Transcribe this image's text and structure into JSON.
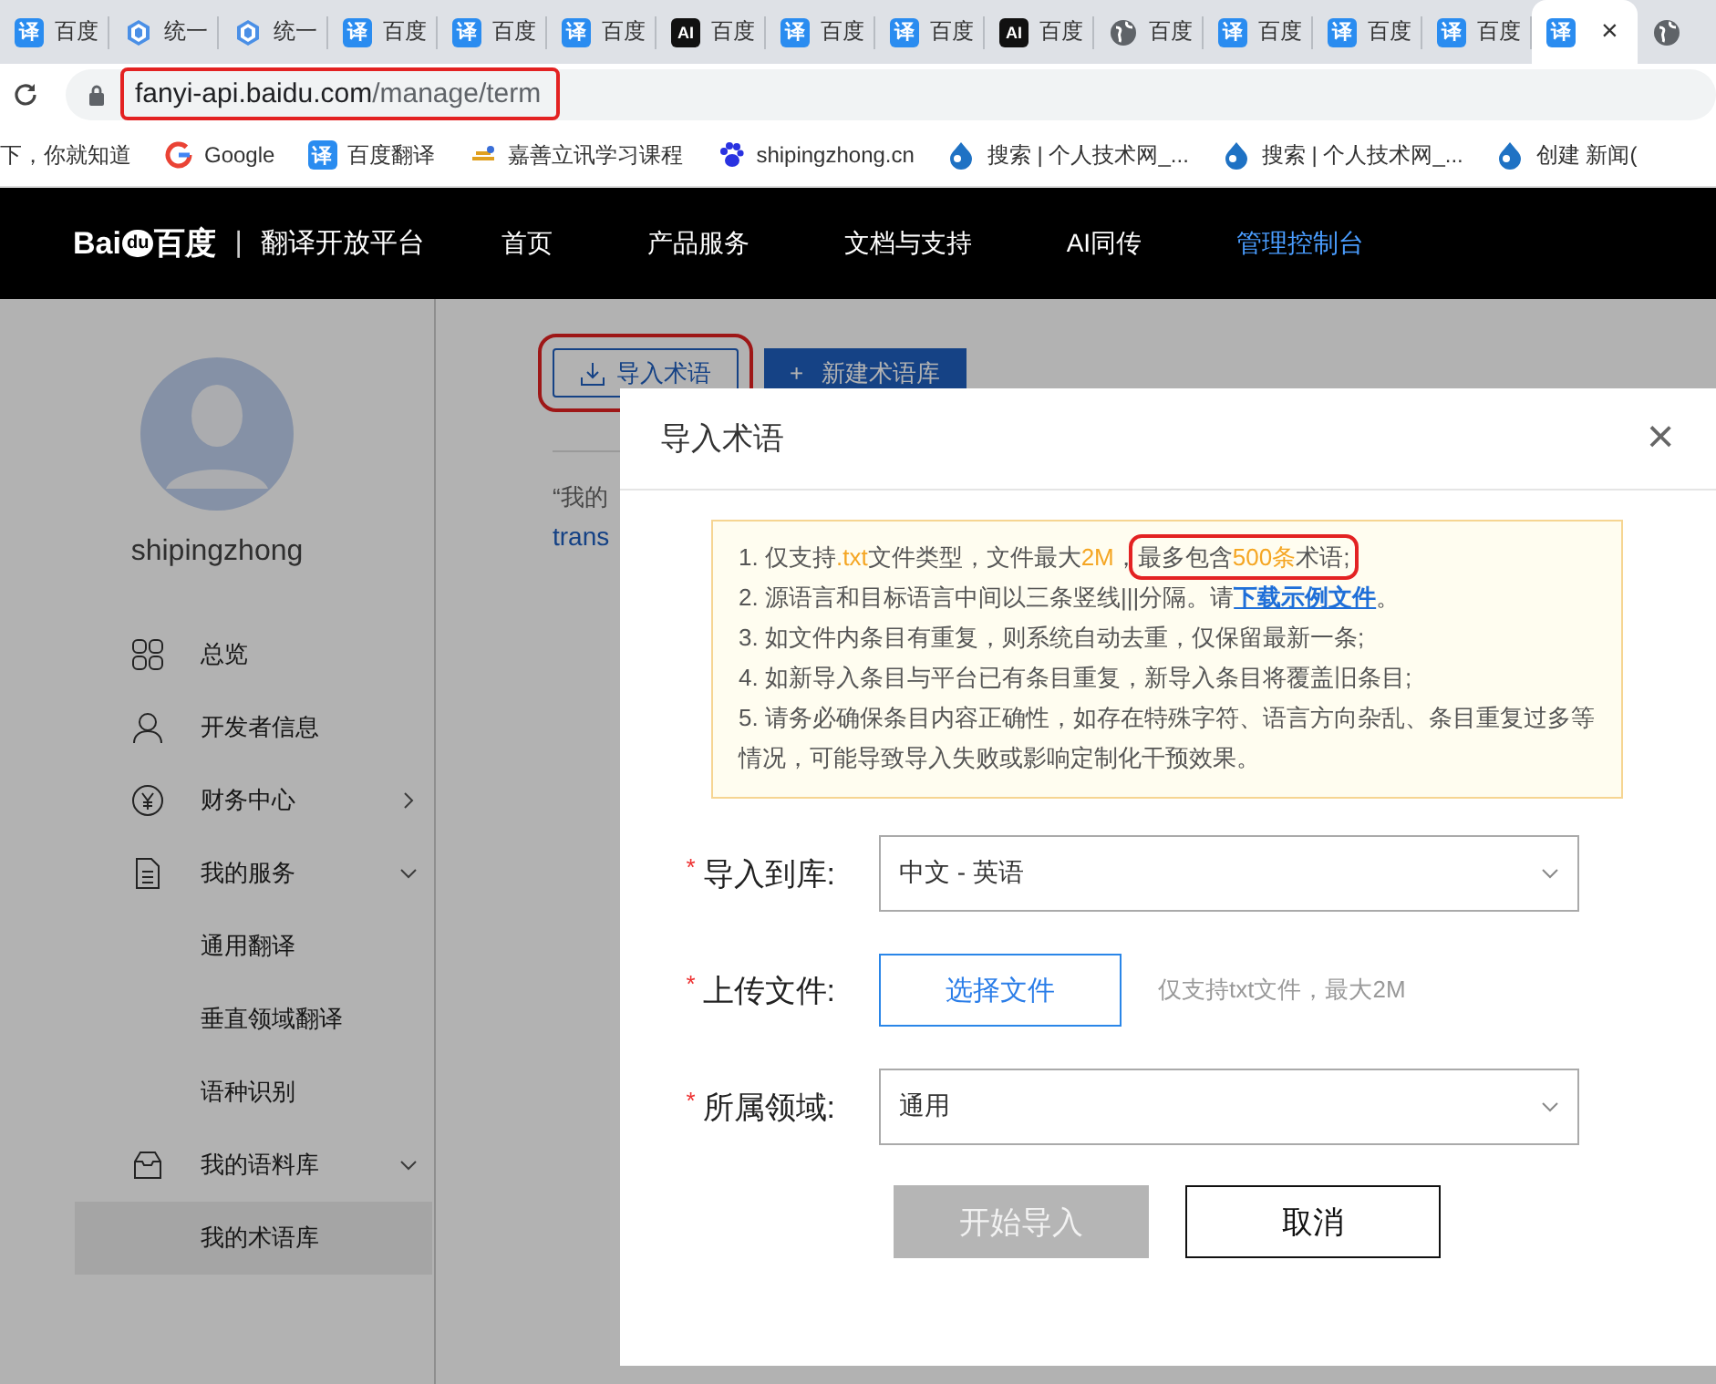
{
  "browser": {
    "tabs": [
      {
        "kind": "translate",
        "glyph": "译",
        "title": "百度",
        "selected": false
      },
      {
        "kind": "cube",
        "title": "统一",
        "selected": false
      },
      {
        "kind": "cube",
        "title": "统一",
        "selected": false
      },
      {
        "kind": "translate",
        "glyph": "译",
        "title": "百度",
        "selected": false
      },
      {
        "kind": "translate",
        "glyph": "译",
        "title": "百度",
        "selected": false
      },
      {
        "kind": "translate",
        "glyph": "译",
        "title": "百度",
        "selected": false
      },
      {
        "kind": "ai",
        "glyph": "AI",
        "title": "百度",
        "selected": false
      },
      {
        "kind": "translate",
        "glyph": "译",
        "title": "百度",
        "selected": false
      },
      {
        "kind": "translate",
        "glyph": "译",
        "title": "百度",
        "selected": false
      },
      {
        "kind": "ai",
        "glyph": "AI",
        "title": "百度",
        "selected": false
      },
      {
        "kind": "globe",
        "title": "百度",
        "selected": false
      },
      {
        "kind": "translate",
        "glyph": "译",
        "title": "百度",
        "selected": false
      },
      {
        "kind": "translate",
        "glyph": "译",
        "title": "百度",
        "selected": false
      },
      {
        "kind": "translate",
        "glyph": "译",
        "title": "百度",
        "selected": false
      },
      {
        "kind": "translate",
        "glyph": "译",
        "close": "×",
        "selected": true
      },
      {
        "kind": "globe",
        "selected": false
      }
    ],
    "address": {
      "host": "fanyi-api.baidu.com",
      "path": "/manage/term",
      "annotated": true
    },
    "bookmarks": [
      {
        "kind": "plain",
        "title": "下，你就知道"
      },
      {
        "kind": "google",
        "title": "Google"
      },
      {
        "kind": "translate",
        "glyph": "译",
        "title": "百度翻译"
      },
      {
        "kind": "logo",
        "title": "嘉善立讯学习课程"
      },
      {
        "kind": "paw",
        "title": "shipingzhong.cn"
      },
      {
        "kind": "drop",
        "title": "搜索 | 个人技术网_..."
      },
      {
        "kind": "drop",
        "title": "搜索 | 个人技术网_..."
      },
      {
        "kind": "drop",
        "title": "创建 新闻("
      }
    ]
  },
  "site_nav": {
    "logo": {
      "left": "Bai",
      "inner": "du",
      "right": "百度"
    },
    "separator": "|",
    "platform": "翻译开放平台",
    "items": [
      {
        "label": "首页",
        "selected": false
      },
      {
        "label": "产品服务",
        "selected": false
      },
      {
        "label": "文档与支持",
        "selected": false
      },
      {
        "label": "AI同传",
        "selected": false
      },
      {
        "label": "管理控制台",
        "selected": true
      }
    ]
  },
  "sidebar": {
    "username": "shipingzhong",
    "items": [
      {
        "kind": "overview",
        "label": "总览",
        "selected": false
      },
      {
        "kind": "profile",
        "label": "开发者信息",
        "selected": false
      },
      {
        "kind": "finance",
        "label": "财务中心",
        "expanded": false,
        "selected": false
      },
      {
        "kind": "services",
        "label": "我的服务",
        "expanded": true,
        "selected": false,
        "children": [
          {
            "label": "通用翻译",
            "selected": false
          },
          {
            "label": "垂直领域翻译",
            "selected": false
          },
          {
            "label": "语种识别",
            "selected": false
          }
        ]
      },
      {
        "kind": "corpus",
        "label": "我的语料库",
        "expanded": true,
        "selected": false,
        "children": [
          {
            "label": "我的术语库",
            "selected": true
          }
        ]
      }
    ]
  },
  "main": {
    "buttons": [
      {
        "kind": "outline",
        "label": "导入术语",
        "annotated": true
      },
      {
        "kind": "primary",
        "prefix": "+",
        "label": "新建术语库",
        "annotated": false
      }
    ],
    "intro": "“我的",
    "link": "trans"
  },
  "dialog": {
    "title": "导入术语",
    "close": "×",
    "notice": [
      [
        {
          "kind": "plain",
          "text": "1. 仅支持"
        },
        {
          "kind": "highlight",
          "text": ".txt"
        },
        {
          "kind": "plain",
          "text": "文件类型，文件最大"
        },
        {
          "kind": "highlight",
          "text": "2M"
        },
        {
          "kind": "plain",
          "text": "，"
        },
        {
          "kind": "annotation",
          "parts": [
            {
              "kind": "plain",
              "text": "最多包含"
            },
            {
              "kind": "highlight",
              "text": "500条"
            },
            {
              "kind": "plain",
              "text": "术语;"
            }
          ]
        }
      ],
      [
        {
          "kind": "plain",
          "text": "2. 源语言和目标语言中间以三条竖线|||分隔。请"
        },
        {
          "kind": "link",
          "text": "下载示例文件"
        },
        {
          "kind": "plain",
          "text": "。"
        }
      ],
      [
        {
          "kind": "plain",
          "text": "3. 如文件内条目有重复，则系统自动去重，仅保留最新一条;"
        }
      ],
      [
        {
          "kind": "plain",
          "text": "4. 如新导入条目与平台已有条目重复，新导入条目将覆盖旧条目;"
        }
      ],
      [
        {
          "kind": "plain",
          "text": "5. 请务必确保条目内容正确性，如存在特殊字符、语言方向杂乱、条目重复过多等情况，可能导致导入失败或影响定制化干预效果。"
        }
      ]
    ],
    "fields": [
      {
        "kind": "select",
        "required_mark": "*",
        "label": "导入到库:",
        "value": "中文 - 英语"
      },
      {
        "kind": "file",
        "required_mark": "*",
        "label": "上传文件:",
        "button": "选择文件",
        "hint": "仅支持txt文件，最大2M"
      },
      {
        "kind": "select",
        "required_mark": "*",
        "label": "所属领域:",
        "value": "通用"
      }
    ],
    "actions": [
      {
        "kind": "primary",
        "label": "开始导入",
        "disabled": true
      },
      {
        "kind": "default",
        "label": "取消",
        "disabled": false
      }
    ]
  }
}
